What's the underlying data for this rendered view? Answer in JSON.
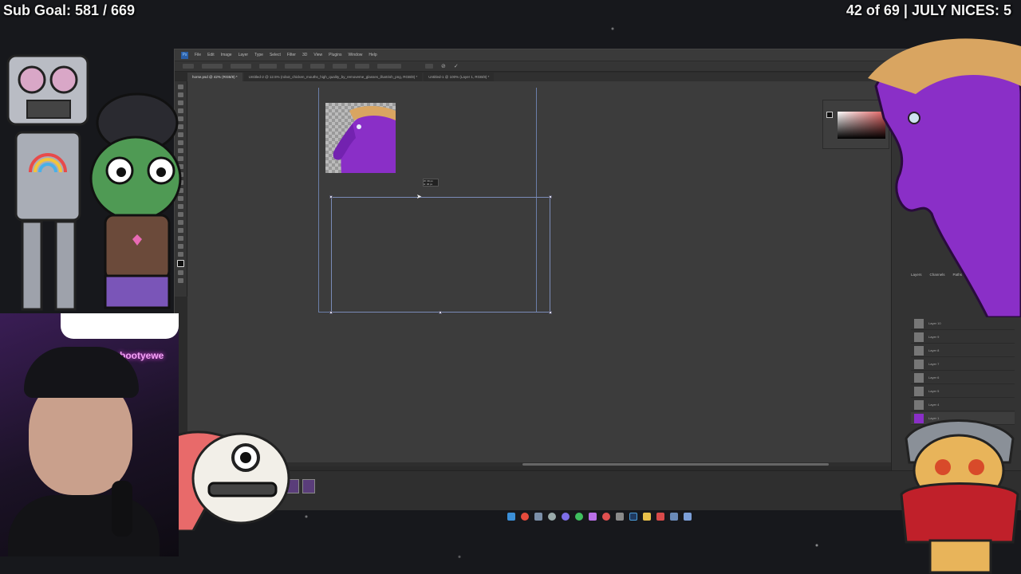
{
  "stream": {
    "sub_goal": "Sub Goal: 581 / 669",
    "nices": "42 of 69 | JULY NICES: 5",
    "webcam_sign": "bootyewe"
  },
  "photoshop": {
    "logo": "Ps",
    "menu": [
      "File",
      "Edit",
      "Image",
      "Layer",
      "Type",
      "Select",
      "Filter",
      "3D",
      "View",
      "Plugins",
      "Window",
      "Help"
    ],
    "tabs": [
      "horse.psd @ 42% (RGB/8) *",
      "Untitled-2 @ 12.5% (robot_chicken_mouths_high_quality_by_removeme_glasses_illustrish_png, RGB/8) *",
      "Untitled-1 @ 100% (Layer 1, RGB/8) *"
    ],
    "tooltip_w": "W: 36 px",
    "tooltip_h": "H: 36 px",
    "panel_tabs": [
      "Layers",
      "Channels",
      "Paths"
    ],
    "layers": [
      "Layer 10",
      "Layer 9",
      "Layer 8",
      "Layer 7",
      "Layer 6",
      "Layer 5",
      "Layer 4",
      "Layer 1"
    ]
  },
  "icons": {
    "taskbar": [
      "windows-icon",
      "chrome-icon",
      "steam-icon",
      "settings-icon",
      "discord-icon",
      "spotify-icon",
      "obs-icon",
      "record-icon",
      "terminal-icon",
      "photoshop-icon",
      "explorer-icon",
      "browser-icon",
      "mail-icon",
      "extra-icon"
    ]
  },
  "colors": {
    "accent_purple": "#8a2fc7",
    "horse_mane": "#d9a561",
    "taskbar": [
      "#3b8fd8",
      "#e64b3c",
      "#7a8ea8",
      "#9aa",
      "#7d6ee8",
      "#3fbf5f",
      "#b96fe8",
      "#e05050",
      "#8a8a8a",
      "#4a9bd8",
      "#e8c04a",
      "#d84a4a",
      "#6a8ab8",
      "#7c9fd8"
    ]
  }
}
